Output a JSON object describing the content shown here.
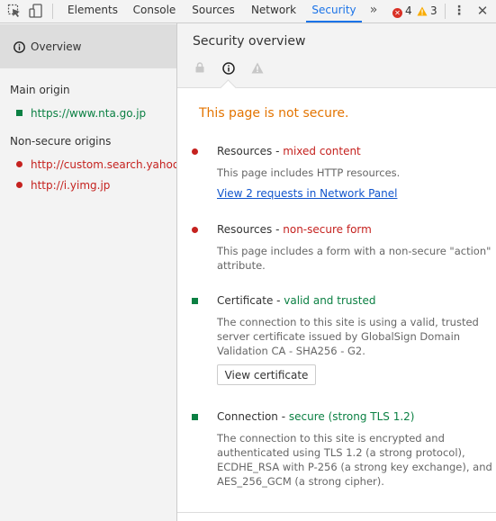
{
  "toolbar": {
    "tabs": [
      {
        "label": "Elements"
      },
      {
        "label": "Console"
      },
      {
        "label": "Sources"
      },
      {
        "label": "Network"
      },
      {
        "label": "Security",
        "active": true
      }
    ],
    "overflow_label": "»",
    "error_count": "4",
    "warning_count": "3",
    "menu_glyph": "⋮",
    "close_glyph": "✕",
    "icons": [
      "inspect-element-icon",
      "device-toolbar-icon",
      "more-tabs-icon",
      "error-icon",
      "warning-icon",
      "kebab-menu-icon",
      "close-icon"
    ]
  },
  "sidebar": {
    "overview_label": "Overview",
    "main_origin_title": "Main origin",
    "main_origin": "https://www.nta.go.jp",
    "non_secure_title": "Non-secure origins",
    "non_secure_origins": [
      "http://custom.search.yahoo.co.jp",
      "http://i.yimg.jp"
    ]
  },
  "main": {
    "title": "Security overview",
    "summary": "This page is not secure.",
    "items": [
      {
        "title_prefix": "Resources - ",
        "title_status": "mixed content",
        "status_color": "red",
        "desc": "This page includes HTTP resources.",
        "link": "View 2 requests in Network Panel"
      },
      {
        "title_prefix": "Resources - ",
        "title_status": "non-secure form",
        "status_color": "red",
        "desc": "This page includes a form with a non-secure \"action\" attribute."
      },
      {
        "title_prefix": "Certificate - ",
        "title_status": "valid and trusted",
        "status_color": "green",
        "desc": "The connection to this site is using a valid, trusted server certificate issued by GlobalSign Domain Validation CA - SHA256 - G2.",
        "button": "View certificate"
      },
      {
        "title_prefix": "Connection - ",
        "title_status": "secure (strong TLS 1.2)",
        "status_color": "green",
        "desc": "The connection to this site is encrypted and authenticated using TLS 1.2 (a strong protocol), ECDHE_RSA with P-256 (a strong key exchange), and AES_256_GCM (a strong cipher)."
      }
    ]
  },
  "colors": {
    "accent": "#1a73e8",
    "insecure": "#c5221f",
    "secure": "#0b8043",
    "warning": "#e37400",
    "link": "#1155cc"
  }
}
